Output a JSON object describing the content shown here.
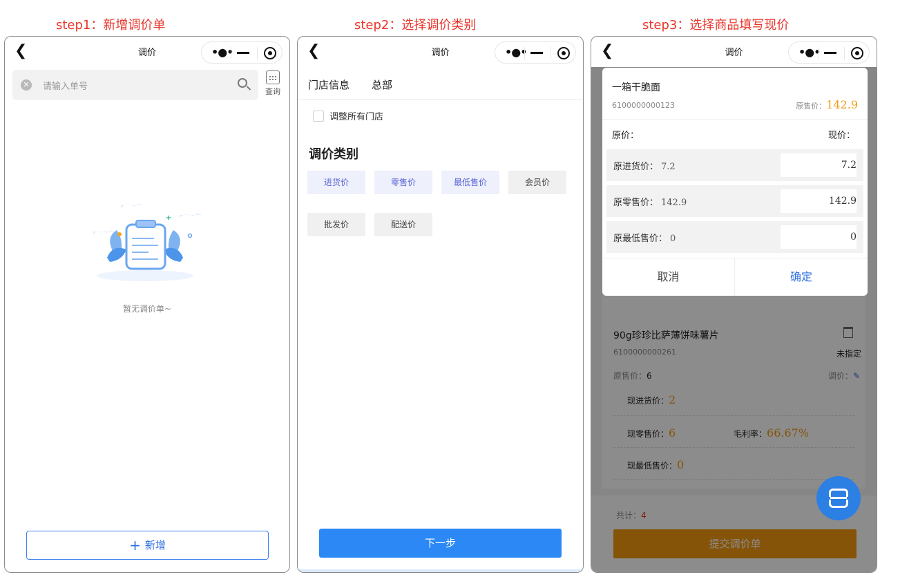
{
  "steps": [
    {
      "title": "step1：新增调价单"
    },
    {
      "title": "step2：选择调价类别"
    },
    {
      "title": "step3：选择商品填写现价"
    }
  ],
  "nav": {
    "title": "调价"
  },
  "phone1": {
    "search_placeholder": "请输入单号",
    "calendar_label": "查询",
    "empty_text": "暂无调价单~",
    "add_label": "新增"
  },
  "phone2": {
    "store_label": "门店信息",
    "store_value": "总部",
    "adjust_all_label": "调整所有门店",
    "category_title": "调价类别",
    "chips": [
      {
        "label": "进货价",
        "selected": true
      },
      {
        "label": "零售价",
        "selected": true
      },
      {
        "label": "最低售价",
        "selected": true
      },
      {
        "label": "会员价",
        "selected": false
      },
      {
        "label": "批发价",
        "selected": false
      },
      {
        "label": "配送价",
        "selected": false
      }
    ],
    "next_label": "下一步"
  },
  "phone3": {
    "background": {
      "product_name": "90g珍珍比萨薄饼味薯片",
      "product_code": "6100000000261",
      "unassigned": "未指定",
      "orig_price_label": "原售价：",
      "orig_price_value": "6",
      "adjust_label": "调价：",
      "cur_purchase_label": "现进货价：",
      "cur_purchase_value": "2",
      "cur_retail_label": "现零售价：",
      "cur_retail_value": "6",
      "margin_label": "毛利率：",
      "margin_value": "66.67%",
      "cur_min_label": "现最低售价：",
      "cur_min_value": "0",
      "total_label": "共计：",
      "total_value": "4",
      "submit_label": "提交调价单"
    },
    "popup": {
      "product_name": "一箱干脆面",
      "product_code": "6100000000123",
      "orig_price_label": "原售价：",
      "orig_price_value": "142.9",
      "col_left": "原价：",
      "col_right": "现价：",
      "rows": [
        {
          "label": "原进货价：",
          "orig": "7.2",
          "current": "7.2"
        },
        {
          "label": "原零售价：",
          "orig": "142.9",
          "current": "142.9"
        },
        {
          "label": "原最低售价：",
          "orig": "0",
          "current": "0"
        }
      ],
      "cancel_label": "取消",
      "ok_label": "确定"
    }
  },
  "colors": {
    "step_title": "#e8342a",
    "primary_blue": "#2b88f5",
    "orange": "#f39a12",
    "chip_selected_text": "#5b66d8"
  }
}
